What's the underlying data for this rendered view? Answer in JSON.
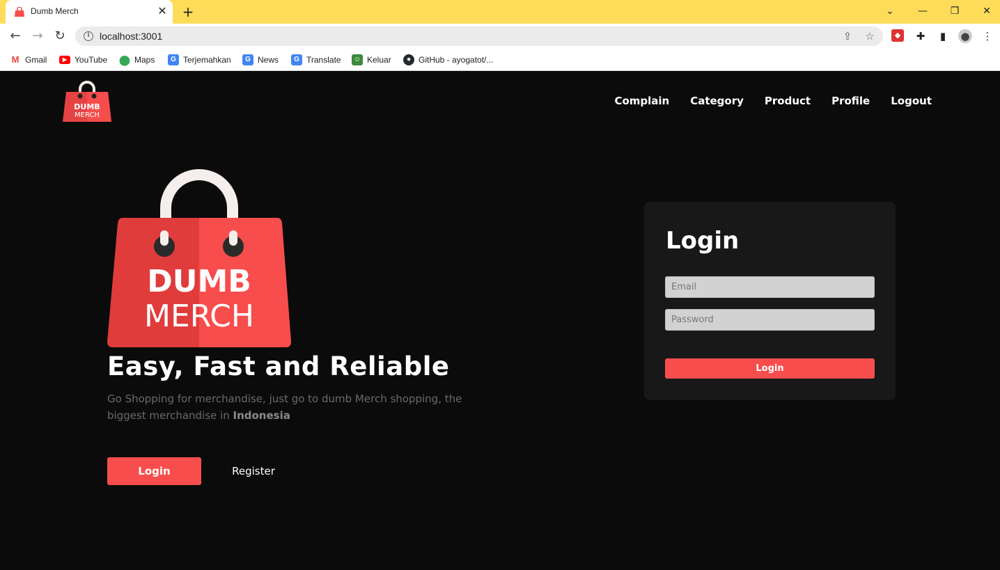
{
  "browser": {
    "tab_title": "Dumb Merch",
    "url": "localhost:3001",
    "bookmarks": [
      {
        "label": "Gmail",
        "icon": "gmail-icon",
        "color": "#ea4335"
      },
      {
        "label": "YouTube",
        "icon": "youtube-icon",
        "color": "#ff0000"
      },
      {
        "label": "Maps",
        "icon": "maps-icon",
        "color": "#34a853"
      },
      {
        "label": "Terjemahkan",
        "icon": "translate-icon",
        "color": "#4285f4"
      },
      {
        "label": "News",
        "icon": "news-icon",
        "color": "#4285f4"
      },
      {
        "label": "Translate",
        "icon": "translate-icon",
        "color": "#4285f4"
      },
      {
        "label": "Keluar",
        "icon": "keluar-icon",
        "color": "#3c8a3c"
      },
      {
        "label": "GitHub - ayogatot/...",
        "icon": "github-icon",
        "color": "#24292e"
      }
    ]
  },
  "brand": {
    "logo_line1": "DUMB",
    "logo_line2": "MERCH",
    "primary_color": "#f74d4d",
    "background_color": "#0b0b0b"
  },
  "navbar": {
    "links": [
      "Complain",
      "Category",
      "Product",
      "Profile",
      "Logout"
    ]
  },
  "hero": {
    "title": "Easy, Fast and Reliable",
    "description_prefix": "Go Shopping for merchandise, just go to dumb Merch shopping, the biggest merchandise in ",
    "description_bold": "Indonesia",
    "login_label": "Login",
    "register_label": "Register"
  },
  "login_form": {
    "title": "Login",
    "email_placeholder": "Email",
    "password_placeholder": "Password",
    "submit_label": "Login"
  }
}
